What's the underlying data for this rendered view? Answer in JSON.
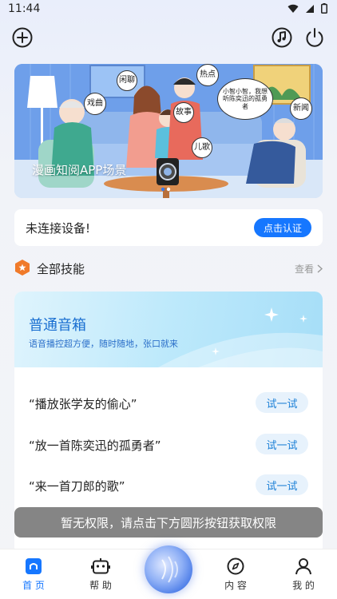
{
  "status_bar": {
    "time": "11:44"
  },
  "banner": {
    "caption": "漫画知阅APP场景",
    "bubbles": {
      "b1": "闲聊",
      "b2": "戏曲",
      "b3": "热点",
      "b4": "小智小智，我想听陈奕迅的孤勇者",
      "b5": "新闻",
      "b6": "故事",
      "b7": "儿歌"
    }
  },
  "device": {
    "status": "未连接设备!",
    "auth_label": "点击认证"
  },
  "skills": {
    "title": "全部技能",
    "view_more": "查看"
  },
  "speaker": {
    "title": "普通音箱",
    "subtitle": "语音播控超方便，随时随地，张口就来",
    "commands": [
      {
        "text": "“播放张学友的偷心”",
        "try_label": "试一试"
      },
      {
        "text": "“放一首陈奕迅的孤勇者”",
        "try_label": "试一试"
      },
      {
        "text": "“来一首刀郎的歌”",
        "try_label": "试一试"
      }
    ]
  },
  "toast": {
    "message": "暂无权限，请点击下方圆形按钮获取权限"
  },
  "nav": {
    "home": "首 页",
    "help": "帮 助",
    "content": "内 容",
    "mine": "我 的"
  },
  "colors": {
    "accent": "#1677ff",
    "skill_badge": "#f07a2a"
  }
}
